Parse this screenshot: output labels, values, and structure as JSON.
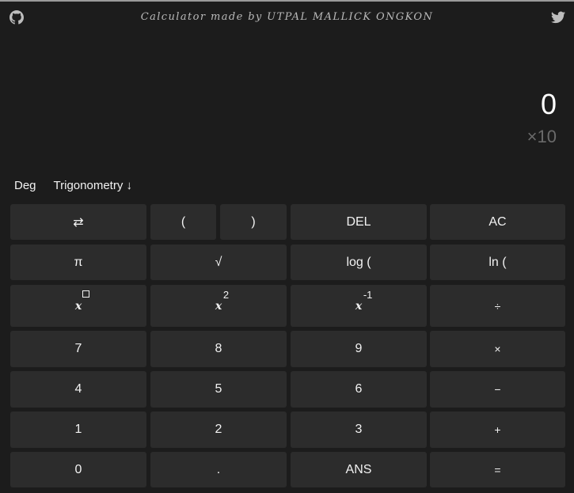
{
  "header": {
    "title": "Calculator made by UTPAL MALLICK ONGKON",
    "github_icon": "github-icon",
    "twitter_icon": "twitter-icon"
  },
  "display": {
    "value": "0",
    "exponent": "×10"
  },
  "modes": {
    "angle": "Deg",
    "functions": "Trigonometry ↓"
  },
  "keys": {
    "swap": "⇄",
    "open_paren": "(",
    "close_paren": ")",
    "del": "DEL",
    "ac": "AC",
    "pi": "π",
    "sqrt": "√",
    "log": "log (",
    "ln": "ln (",
    "x_base": "x",
    "x_pow_2_sup": "2",
    "x_inv_sup": "-1",
    "divide": "÷",
    "d7": "7",
    "d8": "8",
    "d9": "9",
    "multiply": "×",
    "d4": "4",
    "d5": "5",
    "d6": "6",
    "minus": "−",
    "d1": "1",
    "d2": "2",
    "d3": "3",
    "plus": "+",
    "d0": "0",
    "dot": ".",
    "ans": "ANS",
    "equals": "="
  },
  "colors": {
    "background": "#1c1c1c",
    "key": "#2c2c2c",
    "text": "#f2f2f2",
    "muted": "#6a6a6a"
  }
}
